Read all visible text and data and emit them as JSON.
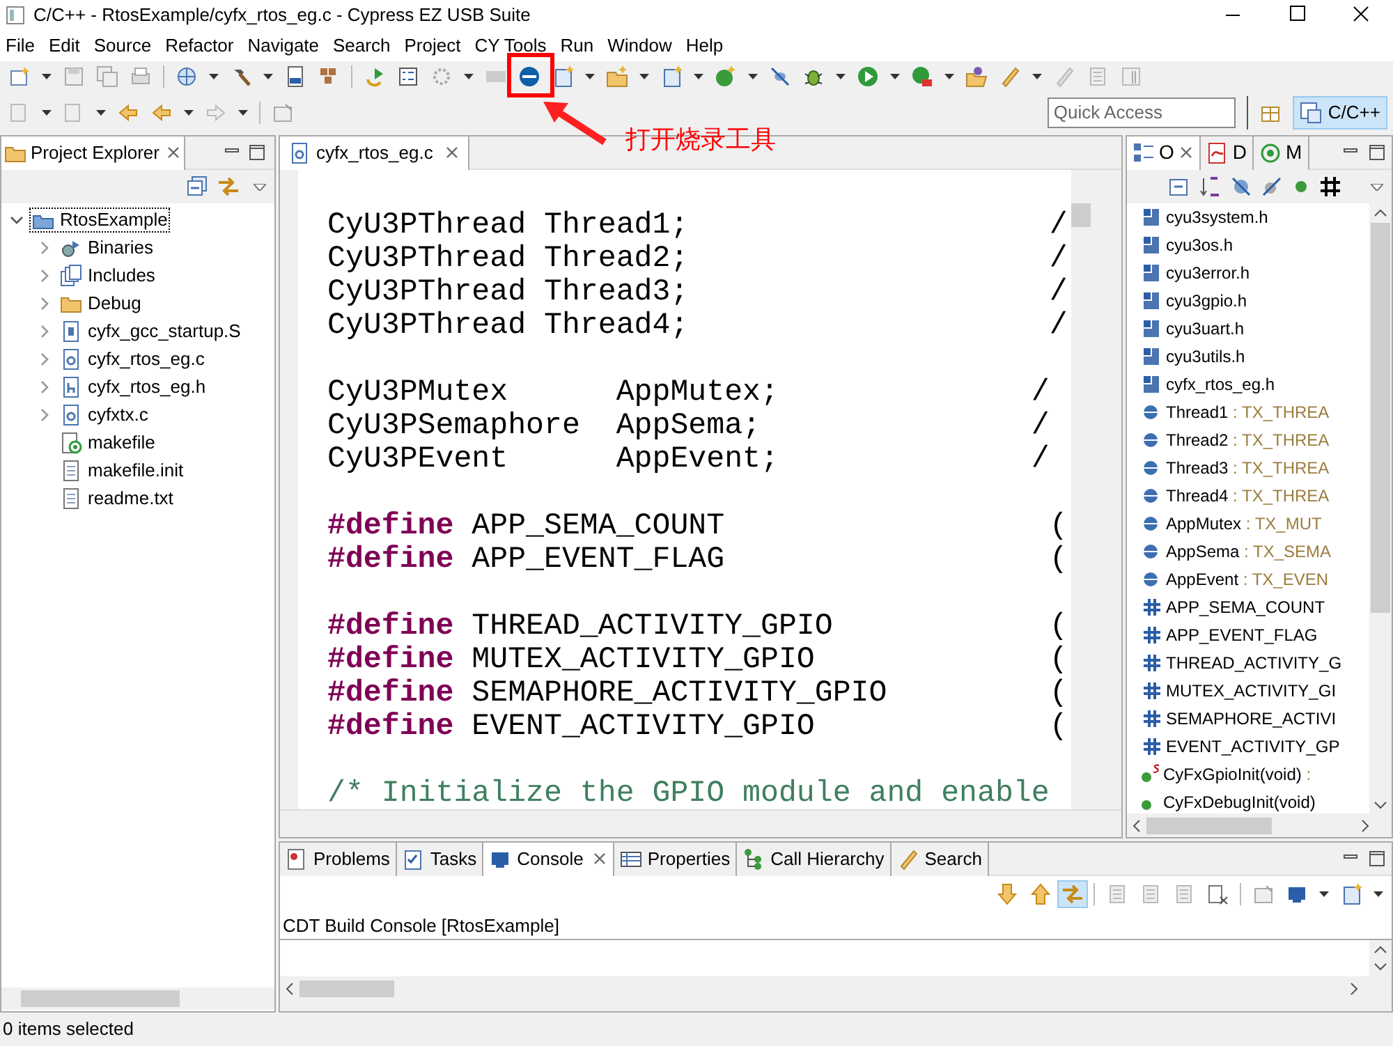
{
  "window": {
    "title": "C/C++ - RtosExample/cyfx_rtos_eg.c - Cypress EZ USB Suite"
  },
  "menu": [
    "File",
    "Edit",
    "Source",
    "Refactor",
    "Navigate",
    "Search",
    "Project",
    "CY Tools",
    "Run",
    "Window",
    "Help"
  ],
  "quick_access": {
    "placeholder": "Quick Access"
  },
  "perspective": {
    "label": "C/C++",
    "selected": true
  },
  "annotation": {
    "text": "打开烧录工具"
  },
  "project_explorer": {
    "title": "Project Explorer",
    "tree": [
      {
        "label": "RtosExample",
        "kind": "project",
        "selected": true,
        "expanded": true,
        "children": [
          {
            "label": "Binaries",
            "kind": "binaries",
            "selected": false,
            "expanded": false
          },
          {
            "label": "Includes",
            "kind": "includes",
            "selected": false,
            "expanded": false
          },
          {
            "label": "Debug",
            "kind": "folder",
            "selected": false,
            "expanded": false
          },
          {
            "label": "cyfx_gcc_startup.S",
            "kind": "asm",
            "selected": false,
            "expanded": false
          },
          {
            "label": "cyfx_rtos_eg.c",
            "kind": "c",
            "selected": false,
            "expanded": false
          },
          {
            "label": "cyfx_rtos_eg.h",
            "kind": "h",
            "selected": false,
            "expanded": false
          },
          {
            "label": "cyfxtx.c",
            "kind": "c",
            "selected": false,
            "expanded": false
          },
          {
            "label": "makefile",
            "kind": "makefile",
            "selected": false
          },
          {
            "label": "makefile.init",
            "kind": "text",
            "selected": false
          },
          {
            "label": "readme.txt",
            "kind": "text",
            "selected": false
          }
        ]
      }
    ]
  },
  "editor": {
    "tab": "cyfx_rtos_eg.c",
    "lines": [
      {
        "kind": "code",
        "text": "CyU3PThread Thread1;                    /"
      },
      {
        "kind": "code",
        "text": "CyU3PThread Thread2;                    /"
      },
      {
        "kind": "code",
        "text": "CyU3PThread Thread3;                    /"
      },
      {
        "kind": "code",
        "text": "CyU3PThread Thread4;                    /"
      },
      {
        "kind": "code",
        "gap_before": true,
        "text": "CyU3PMutex      AppMutex;              /"
      },
      {
        "kind": "code",
        "text": "CyU3PSemaphore  AppSema;               /"
      },
      {
        "kind": "code",
        "text": "CyU3PEvent      AppEvent;              /"
      },
      {
        "kind": "define",
        "gap_before": true,
        "keyword": "#define",
        "text": " APP_SEMA_COUNT                  ("
      },
      {
        "kind": "define",
        "keyword": "#define",
        "text": " APP_EVENT_FLAG                  ("
      },
      {
        "kind": "define",
        "gap_before": true,
        "keyword": "#define",
        "text": " THREAD_ACTIVITY_GPIO            ("
      },
      {
        "kind": "define",
        "keyword": "#define",
        "text": " MUTEX_ACTIVITY_GPIO             ("
      },
      {
        "kind": "define",
        "keyword": "#define",
        "text": " SEMAPHORE_ACTIVITY_GPIO         ("
      },
      {
        "kind": "define",
        "keyword": "#define",
        "text": " EVENT_ACTIVITY_GPIO             ("
      },
      {
        "kind": "comment",
        "gap_before": true,
        "text": "/* Initialize the GPIO module and enable"
      }
    ]
  },
  "outline": {
    "tabs": [
      {
        "label": "O",
        "selected": true
      },
      {
        "label": "D",
        "selected": false
      },
      {
        "label": "M",
        "selected": false
      }
    ],
    "items": [
      {
        "kind": "include",
        "name": "cyu3system.h"
      },
      {
        "kind": "include",
        "name": "cyu3os.h"
      },
      {
        "kind": "include",
        "name": "cyu3error.h"
      },
      {
        "kind": "include",
        "name": "cyu3gpio.h"
      },
      {
        "kind": "include",
        "name": "cyu3uart.h"
      },
      {
        "kind": "include",
        "name": "cyu3utils.h"
      },
      {
        "kind": "include",
        "name": "cyfx_rtos_eg.h"
      },
      {
        "kind": "variable",
        "name": "Thread1",
        "type": ": TX_THREA"
      },
      {
        "kind": "variable",
        "name": "Thread2",
        "type": ": TX_THREA"
      },
      {
        "kind": "variable",
        "name": "Thread3",
        "type": ": TX_THREA"
      },
      {
        "kind": "variable",
        "name": "Thread4",
        "type": ": TX_THREA"
      },
      {
        "kind": "variable",
        "name": "AppMutex",
        "type": ": TX_MUT"
      },
      {
        "kind": "variable",
        "name": "AppSema",
        "type": ": TX_SEMA"
      },
      {
        "kind": "variable",
        "name": "AppEvent",
        "type": ": TX_EVEN"
      },
      {
        "kind": "macro",
        "name": "APP_SEMA_COUNT"
      },
      {
        "kind": "macro",
        "name": "APP_EVENT_FLAG"
      },
      {
        "kind": "macro",
        "name": "THREAD_ACTIVITY_G"
      },
      {
        "kind": "macro",
        "name": "MUTEX_ACTIVITY_GI"
      },
      {
        "kind": "macro",
        "name": "SEMAPHORE_ACTIVI"
      },
      {
        "kind": "macro",
        "name": "EVENT_ACTIVITY_GP"
      },
      {
        "kind": "function",
        "static": true,
        "name": "CyFxGpioInit(void)",
        "type": ":"
      },
      {
        "kind": "function",
        "static": false,
        "name": "CyFxDebugInit(void)"
      }
    ]
  },
  "bottom_panel": {
    "tabs": [
      {
        "label": "Problems",
        "selected": false
      },
      {
        "label": "Tasks",
        "selected": false
      },
      {
        "label": "Console",
        "selected": true
      },
      {
        "label": "Properties",
        "selected": false
      },
      {
        "label": "Call Hierarchy",
        "selected": false
      },
      {
        "label": "Search",
        "selected": false
      }
    ],
    "console_title": "CDT Build Console [RtosExample]"
  },
  "status_bar": {
    "text": "0 items selected"
  }
}
